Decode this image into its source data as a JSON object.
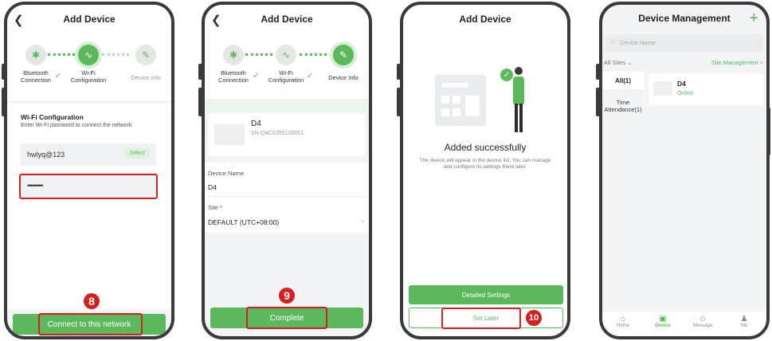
{
  "screen1": {
    "title": "Add Device",
    "steps": [
      "Bluetooth\nConnection",
      "Wi-Fi\nConfiguration",
      "Device Info"
    ],
    "wifi_heading": "Wi-Fi Configuration",
    "wifi_desc": "Enter Wi-Fi password to connect the network",
    "ssid_value": "hwlyq@123",
    "select_label": "Select",
    "password_value": "•••••••••",
    "badge": "8",
    "connect_label": "Connect to this network"
  },
  "screen2": {
    "title": "Add Device",
    "steps": [
      "Bluetooth\nConnection",
      "Wi-Fi\nConfiguration",
      "Device Info"
    ],
    "device_name": "D4",
    "device_sn": "SN-Q4CS255100051",
    "name_label": "Device Name",
    "name_value": "D4",
    "site_label": "Site",
    "site_required": "*",
    "site_value": "DEFAULT (UTC+08:00)",
    "badge": "9",
    "complete_label": "Complete"
  },
  "screen3": {
    "title": "Add Device",
    "success_title": "Added successfully",
    "success_desc": "The device will appear in the device list. You can manage and configure its settings there later.",
    "detailed_label": "Detailed Settings",
    "set_later_label": "Set Later",
    "badge": "10"
  },
  "screen4": {
    "title": "Device Management",
    "add_symbol": "+",
    "search_placeholder": "Device Name",
    "site_filter": "All Sites",
    "site_management": "Site Management >",
    "categories": [
      {
        "label": "All(1)"
      },
      {
        "label": "Time\nAttendance(1)"
      }
    ],
    "device_name": "D4",
    "device_status": "Online",
    "nav": [
      {
        "label": "Home"
      },
      {
        "label": "Device"
      },
      {
        "label": "Message"
      },
      {
        "label": "Me"
      }
    ]
  },
  "colors": {
    "accent": "#5cb85c",
    "highlight": "#d62020"
  }
}
